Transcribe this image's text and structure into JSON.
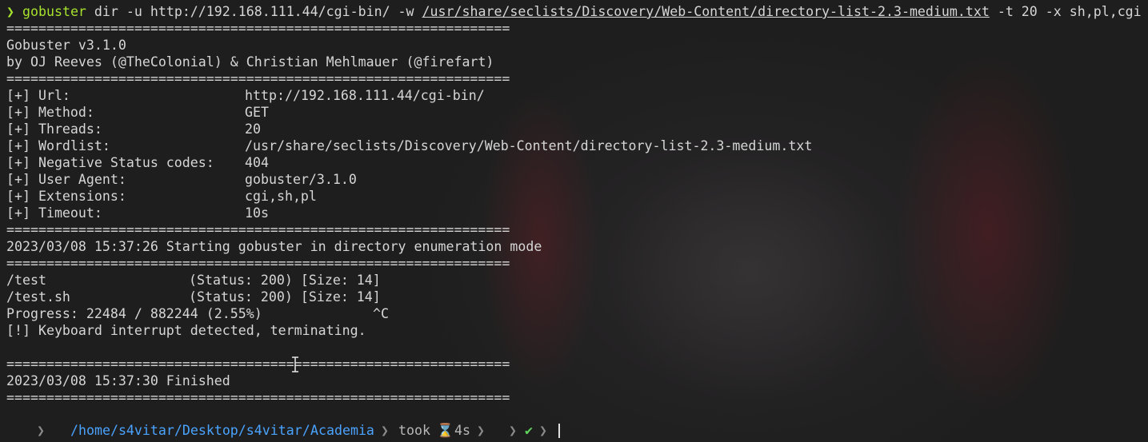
{
  "command": {
    "prompt_symbol": "❯",
    "program": "gobuster",
    "args_before": " dir -u http://192.168.111.44/cgi-bin/ -w ",
    "wordlist_path": "/usr/share/seclists/Discovery/Web-Content/directory-list-2.3-medium.txt",
    "args_after": " -t 20 -x sh,pl,cgi"
  },
  "separator": "===============================================================",
  "banner": {
    "version": "Gobuster v3.1.0",
    "authors": "by OJ Reeves (@TheColonial) & Christian Mehlmauer (@firefart)"
  },
  "config": [
    {
      "label": "[+] Url:",
      "value": "http://192.168.111.44/cgi-bin/"
    },
    {
      "label": "[+] Method:",
      "value": "GET"
    },
    {
      "label": "[+] Threads:",
      "value": "20"
    },
    {
      "label": "[+] Wordlist:",
      "value": "/usr/share/seclists/Discovery/Web-Content/directory-list-2.3-medium.txt"
    },
    {
      "label": "[+] Negative Status codes:",
      "value": "404"
    },
    {
      "label": "[+] User Agent:",
      "value": "gobuster/3.1.0"
    },
    {
      "label": "[+] Extensions:",
      "value": "cgi,sh,pl"
    },
    {
      "label": "[+] Timeout:",
      "value": "10s"
    }
  ],
  "start_message": "2023/03/08 15:37:26 Starting gobuster in directory enumeration mode",
  "results": [
    {
      "path": "/test",
      "status": "(Status: 200) [Size: 14]"
    },
    {
      "path": "/test.sh",
      "status": "(Status: 200) [Size: 14]"
    }
  ],
  "progress": {
    "text": "Progress: 22484 / 882244 (2.55%)",
    "ctrl": "^C"
  },
  "interrupt_message": "[!] Keyboard interrupt detected, terminating.",
  "finish_message": "2023/03/08 15:37:30 Finished",
  "prompt": {
    "os_icon": "linux-penguin-icon",
    "folder_icon": "folder-icon",
    "path_parent": "/home/s4vitar/Desktop/s4vitar/",
    "path_current": "Academia",
    "took_label": "took",
    "duration": "4s",
    "hourglass": "⌛",
    "status_ok": "✔"
  },
  "colors": {
    "command_green": "#a6e22e",
    "path_blue": "#4aa3ff",
    "text": "#d6d6d6"
  }
}
